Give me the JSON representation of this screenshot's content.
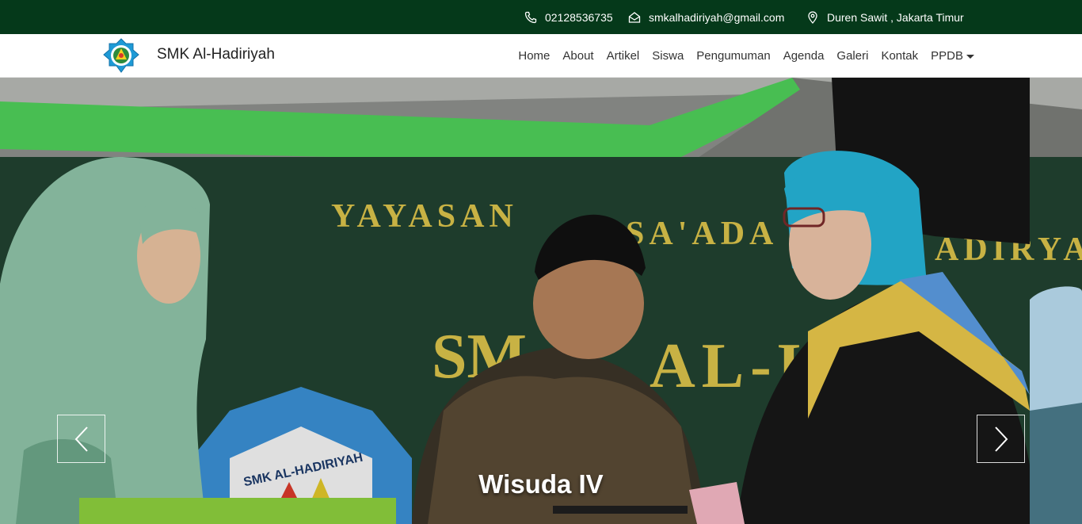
{
  "topbar": {
    "phone": "02128536735",
    "email": "smkalhadiriyah@gmail.com",
    "location": "Duren Sawit , Jakarta Timur",
    "icons": [
      "phone-icon",
      "envelope-icon",
      "map-pin-icon"
    ],
    "background": "#05391a"
  },
  "brand": {
    "name": "SMK Al-Hadiriyah",
    "logo_icon": "school-emblem-icon"
  },
  "nav": {
    "items": [
      "Home",
      "About",
      "Artikel",
      "Siswa",
      "Pengumuman",
      "Agenda",
      "Galeri",
      "Kontak",
      "PPDB"
    ]
  },
  "hero": {
    "caption": "Wisuda IV",
    "banner_text_1": "YAYASAN",
    "banner_text_2": "SA'ADA",
    "banner_text_3": "ADIRYA",
    "banner_text_4": "SM",
    "banner_text_5": "AL-H",
    "emblem_text": "SMK AL-HADIRIYAH",
    "prev_icon": "chevron-left-icon",
    "next_icon": "chevron-right-icon"
  }
}
